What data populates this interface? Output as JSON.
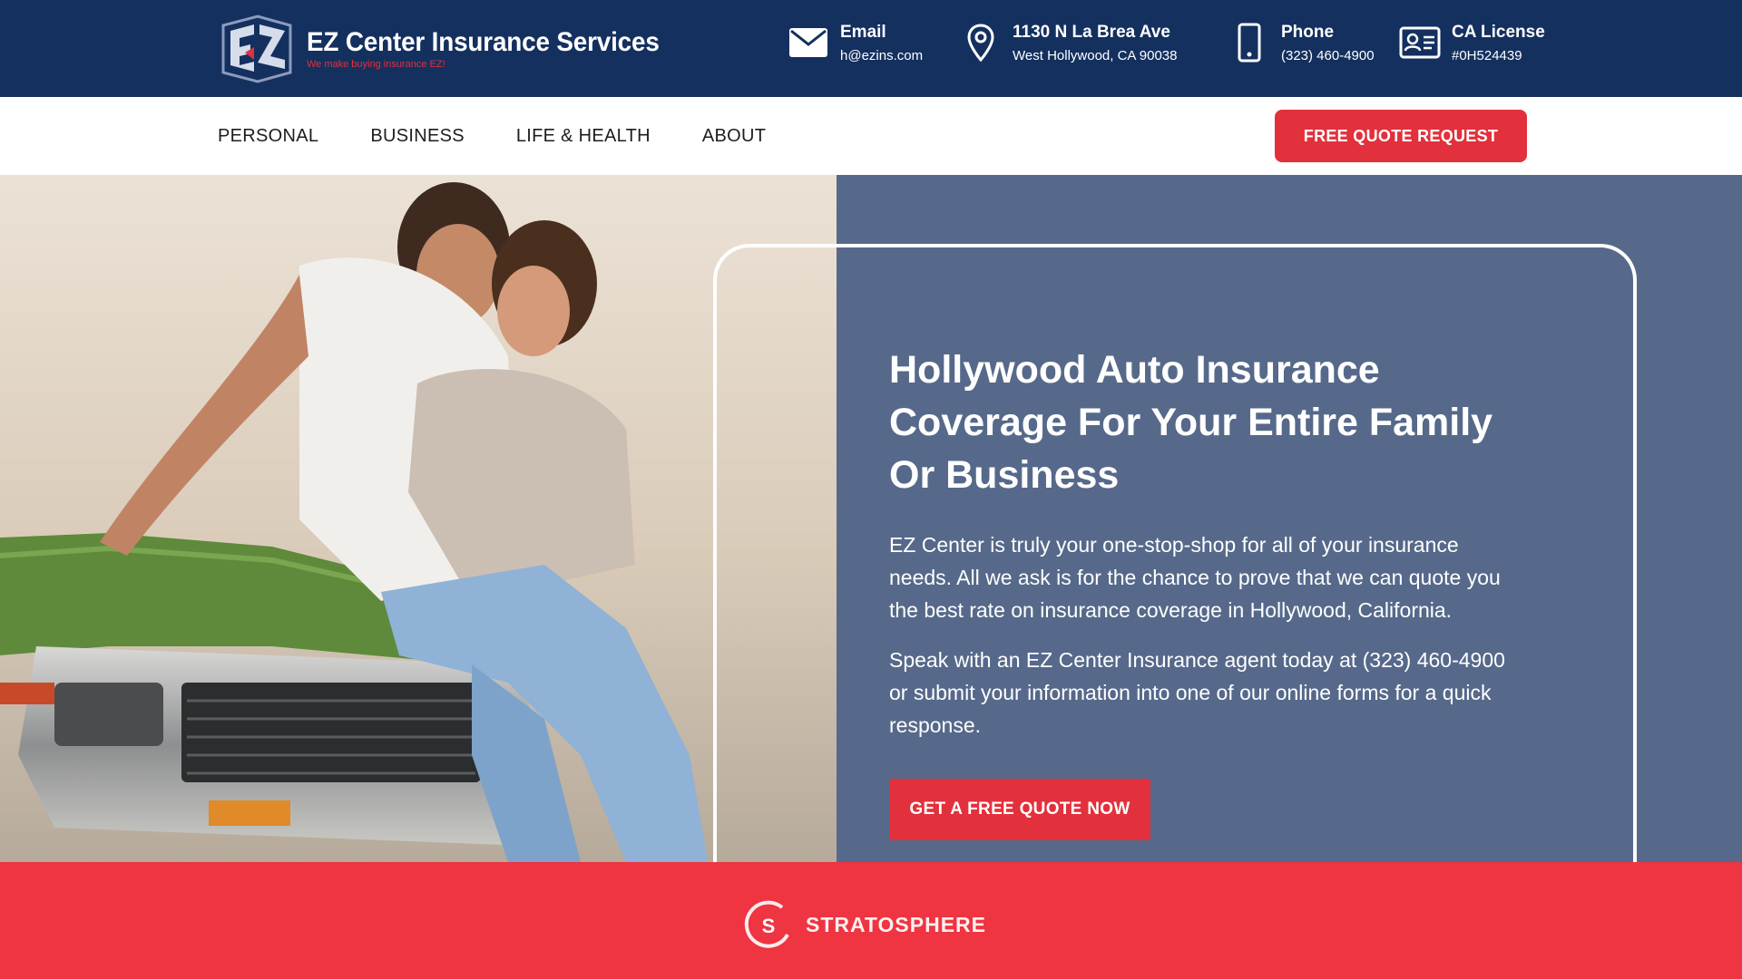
{
  "header": {
    "brand_name": "EZ Center Insurance Services",
    "tagline": "We make buying insurance EZ!",
    "contacts": {
      "email": {
        "title": "Email",
        "value": "h@ezins.com",
        "icon": "envelope-icon"
      },
      "address": {
        "title": "1130 N La Brea Ave",
        "value": "West Hollywood, CA 90038",
        "icon": "map-pin-icon"
      },
      "phone": {
        "title": "Phone",
        "value": "(323) 460-4900",
        "icon": "phone-icon"
      },
      "license": {
        "title": "CA License",
        "value": "#0H524439",
        "icon": "id-card-icon"
      }
    }
  },
  "nav": {
    "items": [
      "PERSONAL",
      "BUSINESS",
      "LIFE & HEALTH",
      "ABOUT"
    ],
    "cta": "FREE QUOTE REQUEST"
  },
  "hero": {
    "title": "Hollywood Auto Insurance Coverage For Your Entire Family Or Business",
    "paragraph1": "EZ Center is truly your one-stop-shop for all of your insurance needs. All we ask is for the chance to prove that we can quote you the best rate on insurance coverage in Hollywood, California.",
    "paragraph2": "Speak with an EZ Center Insurance agent today at (323) 460-4900 or submit your information into one of our online forms for a quick response.",
    "cta": "GET A FREE QUOTE NOW"
  },
  "footer_band": {
    "brand": "STRATOSPHERE"
  },
  "colors": {
    "navy": "#14305f",
    "accent_red": "#e2303c",
    "band_red": "#ef3442",
    "hero_panel": "#56698a"
  }
}
